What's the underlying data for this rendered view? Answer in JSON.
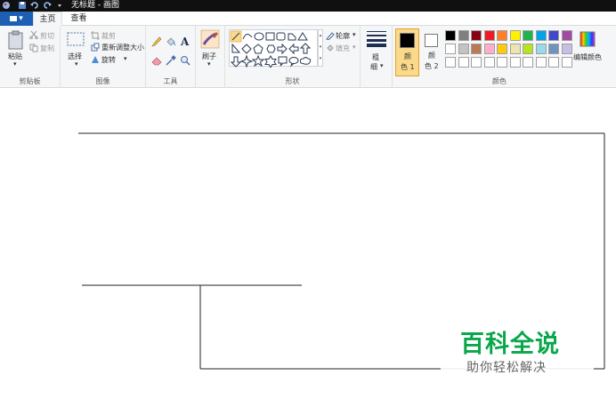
{
  "window": {
    "title": "无标题 - 画图"
  },
  "menu": {
    "file_label": "▾",
    "tabs": [
      {
        "label": "主页"
      },
      {
        "label": "查看"
      }
    ]
  },
  "ribbon": {
    "clipboard": {
      "group_label": "剪贴板",
      "paste": "粘贴",
      "cut": "剪切",
      "copy": "复制"
    },
    "image": {
      "group_label": "图像",
      "select": "选择",
      "crop": "裁剪",
      "resize": "重新调整大小",
      "rotate": "旋转"
    },
    "tools": {
      "group_label": "工具"
    },
    "brushes": {
      "label": "刷子"
    },
    "shapes": {
      "group_label": "形状",
      "outline": "轮廓",
      "fill": "填充"
    },
    "size": {
      "label_line1": "粗",
      "label_line2": "细"
    },
    "colors": {
      "group_label": "颜色",
      "color1_line1": "颜",
      "color1_line2": "色 1",
      "color1_value": "#000000",
      "color2_line1": "颜",
      "color2_line2": "色 2",
      "color2_value": "#ffffff",
      "edit_colors": "编辑颜色",
      "palette_row1": [
        "#000000",
        "#7f7f7f",
        "#880015",
        "#ed1c24",
        "#ff7f27",
        "#fff200",
        "#22b14c",
        "#00a2e8",
        "#3f48cc",
        "#a349a4"
      ],
      "palette_row2": [
        "#ffffff",
        "#c3c3c3",
        "#b97a57",
        "#ffaec9",
        "#ffc90e",
        "#efe4b0",
        "#b5e61d",
        "#99d9ea",
        "#7092be",
        "#c8bfe7"
      ]
    }
  },
  "watermark": {
    "title": "百科全说",
    "subtitle": "助你轻松解决"
  },
  "colors": {
    "accent": "#1d5fb4",
    "selected_tool": "#fbd98a",
    "watermark_green": "#0aa74a"
  }
}
